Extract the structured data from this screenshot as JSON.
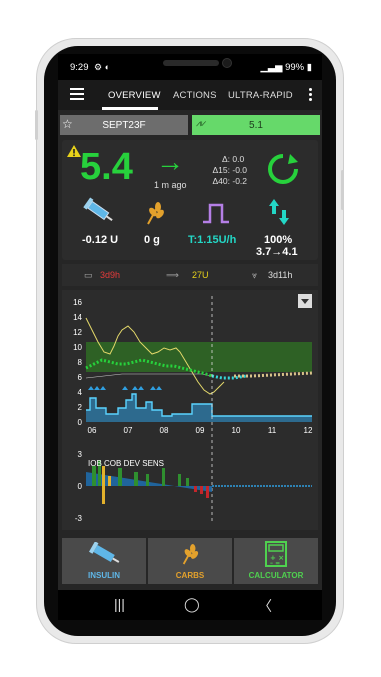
{
  "status": {
    "time": "9:29",
    "battery": "99%"
  },
  "toolbar": {
    "tab_overview": "OVERVIEW",
    "tab_actions": "ACTIONS",
    "tab_ultra": "ULTRA-RAPID"
  },
  "profile": {
    "name": "SEPT23F",
    "target": "5.1"
  },
  "glucose": {
    "value": "5.4",
    "ago": "1 m ago",
    "delta": "0.0",
    "delta15": "-0.0",
    "delta40": "-0.2",
    "delta_label": "Δ:",
    "delta15_label": "Δ15:",
    "delta40_label": "Δ40:"
  },
  "stats": {
    "iob": "-0.12 U",
    "cob": "0 g",
    "temp_basal": "T:1.15U/h",
    "autosens": "100%",
    "autosens_range": "3.7→4.1"
  },
  "banner": {
    "cannula_age": "3d9h",
    "reservoir": "27U",
    "sensor_age": "3d11h"
  },
  "chart_data": [
    {
      "type": "line",
      "x": [
        "06",
        "07",
        "08",
        "09",
        "10",
        "11",
        "12"
      ],
      "yticks": [
        0,
        2,
        4,
        6,
        8,
        10,
        12,
        14,
        16
      ],
      "ylim": [
        0,
        16
      ],
      "series": []
    },
    {
      "type": "area",
      "title": "IOB COB DEV SENS",
      "yticks": [
        3,
        0,
        -3
      ],
      "ylim": [
        -3,
        3
      ],
      "series": []
    }
  ],
  "bottom": {
    "insulin": "INSULIN",
    "carbs": "CARBS",
    "calculator": "CALCULATOR"
  },
  "colors": {
    "bg_green": "#27d13c",
    "target_band": "#2f6b24",
    "basal": "#2f9fe0",
    "accent_yellow": "#e3b12c"
  }
}
